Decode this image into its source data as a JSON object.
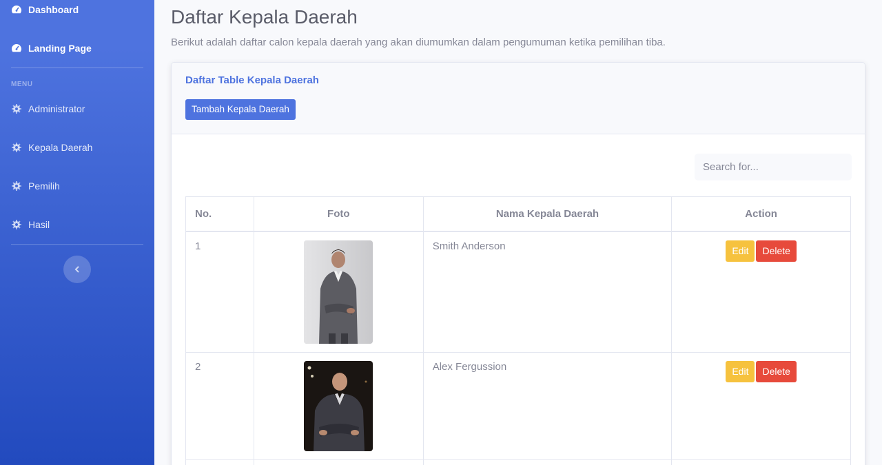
{
  "sidebar": {
    "dashboard": "Dashboard",
    "landing": "Landing Page",
    "heading": "MENU",
    "items": [
      {
        "label": "Administrator"
      },
      {
        "label": "Kepala Daerah"
      },
      {
        "label": "Pemilih"
      },
      {
        "label": "Hasil"
      }
    ]
  },
  "page": {
    "title": "Daftar Kepala Daerah",
    "description": "Berikut adalah daftar calon kepala daerah yang akan diumumkan dalam pengumuman ketika pemilihan tiba."
  },
  "card": {
    "title": "Daftar Table Kepala Daerah",
    "add_button": "Tambah Kepala Daerah"
  },
  "search": {
    "placeholder": "Search for..."
  },
  "table": {
    "headers": [
      "No.",
      "Foto",
      "Nama Kepala Daerah",
      "Action"
    ],
    "rows": [
      {
        "no": "1",
        "name": "Smith Anderson",
        "photo": "man-in-grey-suit-photo"
      },
      {
        "no": "2",
        "name": "Alex Fergussion",
        "photo": "man-in-dark-suit-photo"
      }
    ],
    "edit_label": "Edit",
    "delete_label": "Delete"
  },
  "colors": {
    "primary": "#4e73df",
    "warning": "#f6c23e",
    "danger": "#e74a3b"
  }
}
